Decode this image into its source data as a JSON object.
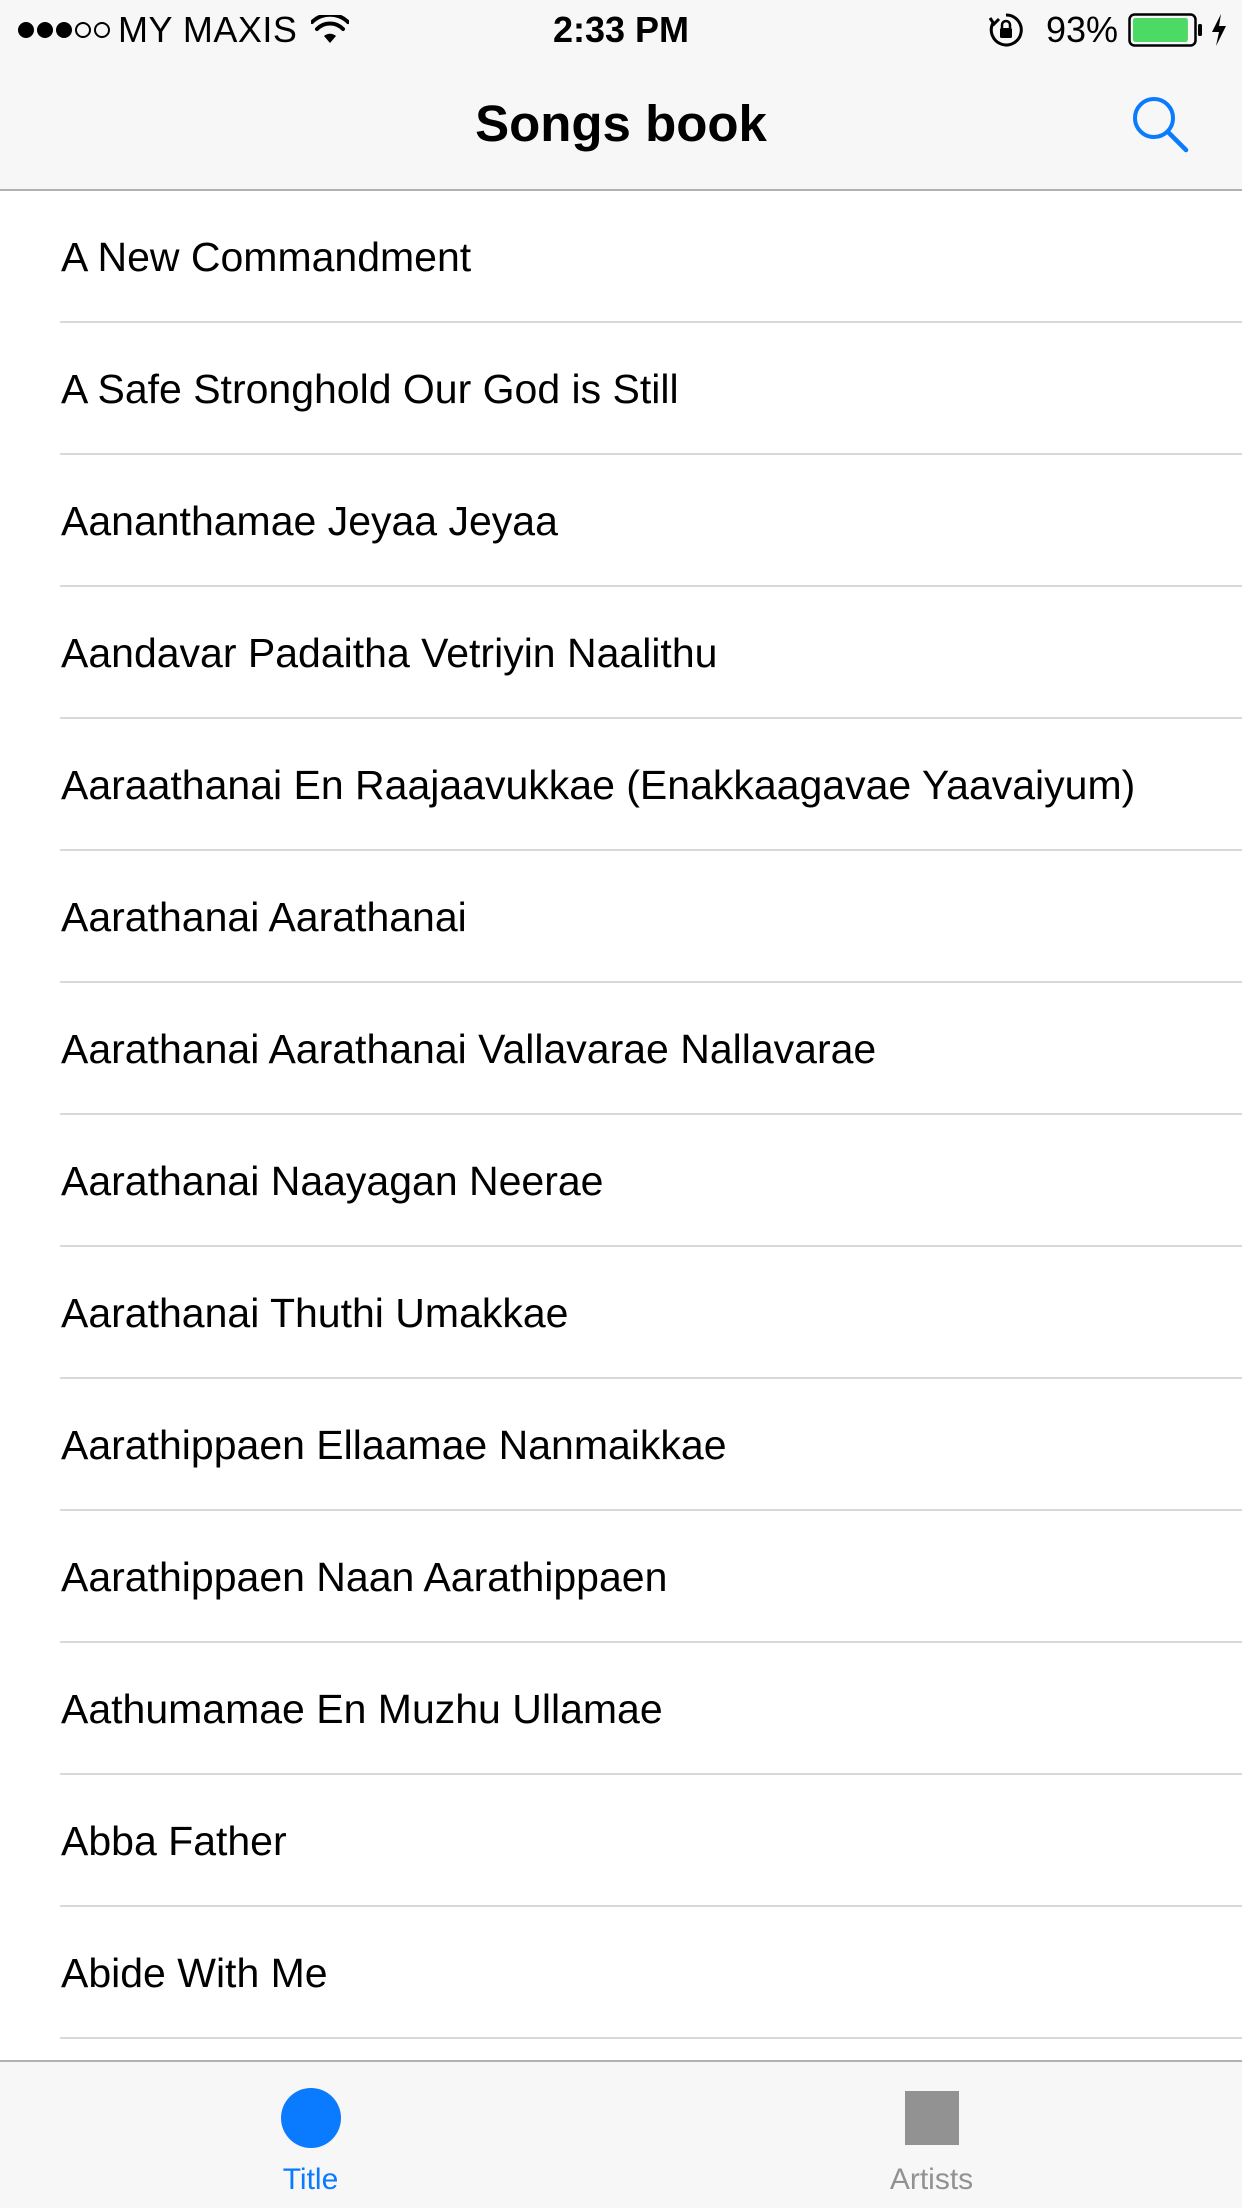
{
  "status_bar": {
    "carrier": "MY MAXIS",
    "signal_full_dots": 3,
    "signal_empty_dots": 2,
    "time": "2:33 PM",
    "battery_percent": "93%",
    "battery_level": 0.93,
    "icons": [
      "signal-dots",
      "wifi-icon",
      "orientation-lock-icon",
      "battery-icon",
      "charging-bolt-icon"
    ]
  },
  "nav_bar": {
    "title": "Songs book",
    "search_icon": "search-icon"
  },
  "songs": [
    "A New Commandment",
    "A Safe Stronghold Our God is Still",
    "Aananthamae Jeyaa Jeyaa",
    "Aandavar Padaitha Vetriyin Naalithu",
    "Aaraathanai En Raajaavukkae (Enakkaagavae Yaavaiyum)",
    "Aarathanai Aarathanai",
    "Aarathanai Aarathanai Vallavarae Nallavarae",
    "Aarathanai Naayagan Neerae",
    "Aarathanai Thuthi Umakkae",
    "Aarathippaen Ellaamae Nanmaikkae",
    "Aarathippaen Naan Aarathippaen",
    "Aathumamae En Muzhu Ullamae",
    "Abba Father",
    "Abide With Me"
  ],
  "tab_bar": {
    "tabs": [
      {
        "label": "Title",
        "icon": "circle-icon",
        "active": true
      },
      {
        "label": "Artists",
        "icon": "square-icon",
        "active": false
      }
    ]
  },
  "colors": {
    "accent": "#0a7aff",
    "inactive": "#929292",
    "bar_background": "#f7f7f7",
    "battery_fill": "#4cd964"
  }
}
